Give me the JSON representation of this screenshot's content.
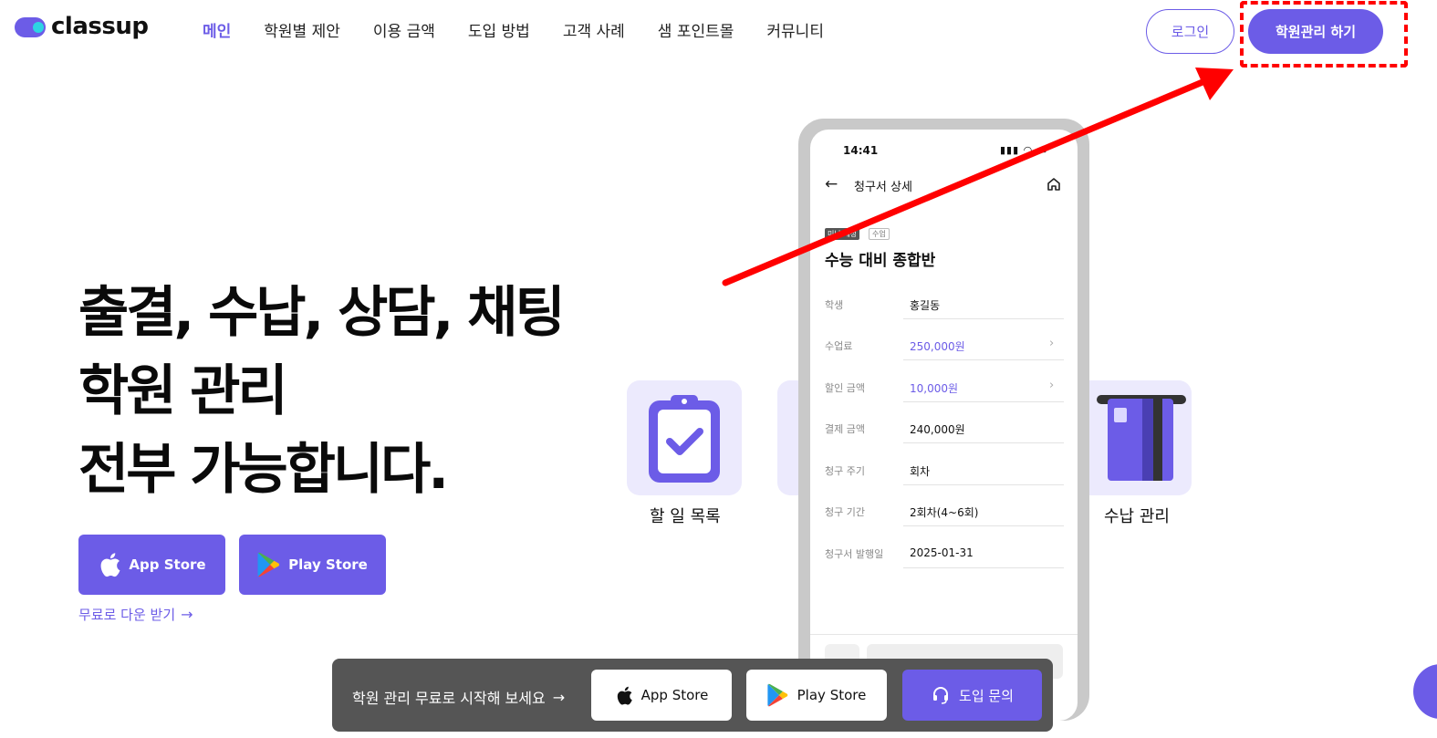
{
  "header": {
    "logo_text": "classup",
    "nav": [
      {
        "label": "메인",
        "active": true
      },
      {
        "label": "학원별 제안",
        "active": false
      },
      {
        "label": "이용 금액",
        "active": false
      },
      {
        "label": "도입 방법",
        "active": false
      },
      {
        "label": "고객 사례",
        "active": false
      },
      {
        "label": "샘 포인트몰",
        "active": false
      },
      {
        "label": "커뮤니티",
        "active": false
      }
    ],
    "login_label": "로그인",
    "manage_label": "학원관리 하기"
  },
  "hero": {
    "title_lines": [
      "출결, 수납, 상담, 채팅",
      "학원 관리",
      "전부 가능합니다."
    ],
    "app_store_label": "App Store",
    "play_store_label": "Play Store",
    "free_download_label": "무료로 다운 받기"
  },
  "features": [
    {
      "label": "할 일 목록",
      "icon": "clipboard-check-icon"
    },
    {
      "label": "수납 관리",
      "icon": "card-icon"
    }
  ],
  "phone": {
    "time": "14:41",
    "screen_title": "청구서 상세",
    "badges": [
      "미납 예정",
      "수업"
    ],
    "course_name": "수능 대비 종합반",
    "rows": [
      {
        "label": "학생",
        "value": "홍길동",
        "accent": false,
        "chevron": false
      },
      {
        "label": "수업료",
        "value": "250,000원",
        "accent": true,
        "chevron": true
      },
      {
        "label": "할인 금액",
        "value": "10,000원",
        "accent": true,
        "chevron": true
      },
      {
        "label": "결제 금액",
        "value": "240,000원",
        "accent": false,
        "chevron": false
      },
      {
        "label": "청구 주기",
        "value": "회차",
        "accent": false,
        "chevron": false
      },
      {
        "label": "청구 기간",
        "value": "2회차(4~6회)",
        "accent": false,
        "chevron": false
      },
      {
        "label": "청구서 발행일",
        "value": "2025-01-31",
        "accent": false,
        "chevron": false
      }
    ]
  },
  "bottom_bar": {
    "text": "학원 관리 무료로 시작해 보세요",
    "app_store_label": "App Store",
    "play_store_label": "Play Store",
    "inquiry_label": "도입 문의"
  },
  "colors": {
    "accent": "#6c5ce7",
    "annotation": "#ff0000",
    "bar": "#555555"
  }
}
